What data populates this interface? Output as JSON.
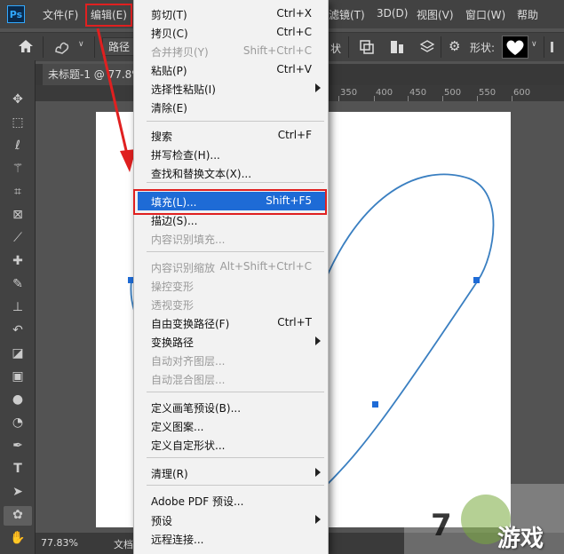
{
  "app": {
    "logo": "Ps"
  },
  "menubar": {
    "items": [
      "文件(F)",
      "编辑(E)",
      "滤镜(T)",
      "3D(D)",
      "视图(V)",
      "窗口(W)",
      "帮助"
    ]
  },
  "options": {
    "path_mode": "路径",
    "shape_label": "形状:",
    "fill_mode": "状"
  },
  "tab": {
    "title": "未标题-1 @ 77.8%"
  },
  "ruler": {
    "ticks": [
      "350",
      "400",
      "450",
      "500",
      "550",
      "600"
    ]
  },
  "status": {
    "zoom": "77.83%",
    "doc_label": "文档"
  },
  "edit_menu": {
    "groups": [
      [
        {
          "label": "剪切(T)",
          "shortcut": "Ctrl+X",
          "disabled": false
        },
        {
          "label": "拷贝(C)",
          "shortcut": "Ctrl+C",
          "disabled": false
        },
        {
          "label": "合并拷贝(Y)",
          "shortcut": "Shift+Ctrl+C",
          "disabled": true
        },
        {
          "label": "粘贴(P)",
          "shortcut": "Ctrl+V",
          "disabled": false
        },
        {
          "label": "选择性粘贴(I)",
          "shortcut": "",
          "submenu": true,
          "disabled": false
        },
        {
          "label": "清除(E)",
          "shortcut": "",
          "disabled": false
        }
      ],
      [
        {
          "label": "搜索",
          "shortcut": "Ctrl+F",
          "disabled": false
        },
        {
          "label": "拼写检查(H)...",
          "shortcut": "",
          "disabled": false
        },
        {
          "label": "查找和替换文本(X)...",
          "shortcut": "",
          "disabled": false
        }
      ],
      [
        {
          "label": "填充(L)...",
          "shortcut": "Shift+F5",
          "disabled": false,
          "highlighted": true
        },
        {
          "label": "描边(S)...",
          "shortcut": "",
          "disabled": false
        },
        {
          "label": "内容识别填充...",
          "shortcut": "",
          "disabled": true
        }
      ],
      [
        {
          "label": "内容识别缩放",
          "shortcut": "Alt+Shift+Ctrl+C",
          "disabled": true
        },
        {
          "label": "操控变形",
          "shortcut": "",
          "disabled": true
        },
        {
          "label": "透视变形",
          "shortcut": "",
          "disabled": true
        },
        {
          "label": "自由变换路径(F)",
          "shortcut": "Ctrl+T",
          "disabled": false
        },
        {
          "label": "变换路径",
          "shortcut": "",
          "submenu": true,
          "disabled": false
        },
        {
          "label": "自动对齐图层...",
          "shortcut": "",
          "disabled": true
        },
        {
          "label": "自动混合图层...",
          "shortcut": "",
          "disabled": true
        }
      ],
      [
        {
          "label": "定义画笔预设(B)...",
          "shortcut": "",
          "disabled": false
        },
        {
          "label": "定义图案...",
          "shortcut": "",
          "disabled": false
        },
        {
          "label": "定义自定形状...",
          "shortcut": "",
          "disabled": false
        }
      ],
      [
        {
          "label": "清理(R)",
          "shortcut": "",
          "submenu": true,
          "disabled": false
        }
      ],
      [
        {
          "label": "Adobe PDF 预设...",
          "shortcut": "",
          "disabled": false
        },
        {
          "label": "预设",
          "shortcut": "",
          "submenu": true,
          "disabled": false
        },
        {
          "label": "远程连接...",
          "shortcut": "",
          "disabled": false
        }
      ]
    ]
  },
  "watermark": {
    "text": "游戏"
  },
  "colors": {
    "accent": "#1e6bd6",
    "highlight_border": "#e02020",
    "path_stroke": "#3a7fc1"
  }
}
